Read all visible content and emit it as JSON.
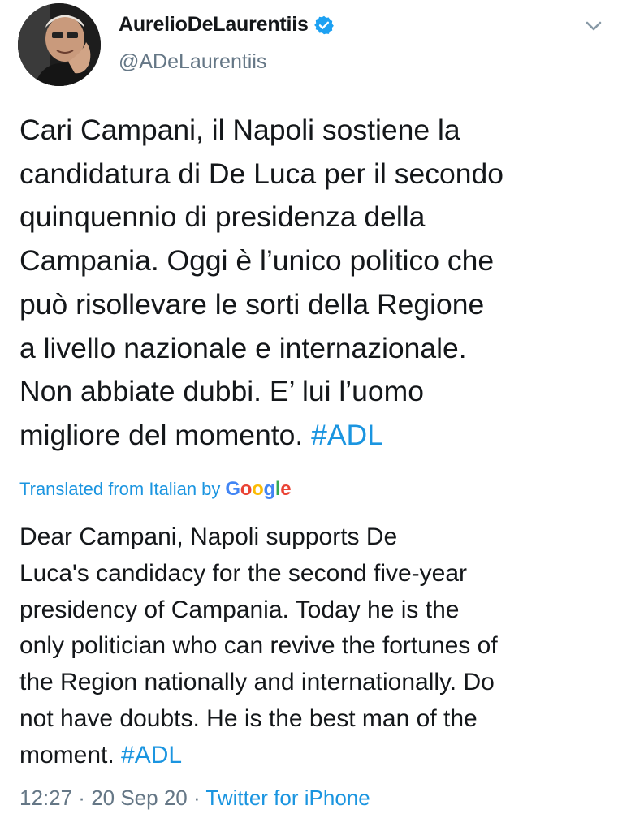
{
  "tweet": {
    "author": {
      "name": "AurelioDeLaurentiis",
      "handle": "@ADeLaurentiis",
      "verified": true
    },
    "body_lines": [
      "Cari Campani, il Napoli sostiene la",
      "candidatura di De Luca per il secondo",
      "quinquennio di presidenza della",
      "Campania. Oggi è l’unico politico che",
      "può risollevare le sorti della Regione",
      "a livello nazionale e internazionale.",
      "Non abbiate dubbi. E’ lui l’uomo",
      "migliore del momento. "
    ],
    "body_hashtag": "#ADL",
    "translation": {
      "label": "Translated from Italian by",
      "provider_letters": [
        "G",
        "o",
        "o",
        "g",
        "l",
        "e"
      ],
      "lines": [
        "Dear Campani, Napoli supports De",
        "Luca's candidacy for the second five-year",
        "presidency of Campania. Today he is the",
        "only politician who can revive the fortunes of",
        "the Region nationally and internationally. Do",
        "not have doubts. He is the best man of the",
        "moment. "
      ],
      "hashtag": "#ADL"
    },
    "meta": {
      "time": "12:27",
      "separator": " · ",
      "date": "20 Sep 20",
      "source": "Twitter for iPhone"
    }
  },
  "colors": {
    "link": "#1b95e0",
    "secondary_text": "#657786",
    "primary_text": "#14171a"
  },
  "icons": {
    "verified": "verified-badge-icon",
    "menu": "chevron-down-icon"
  }
}
